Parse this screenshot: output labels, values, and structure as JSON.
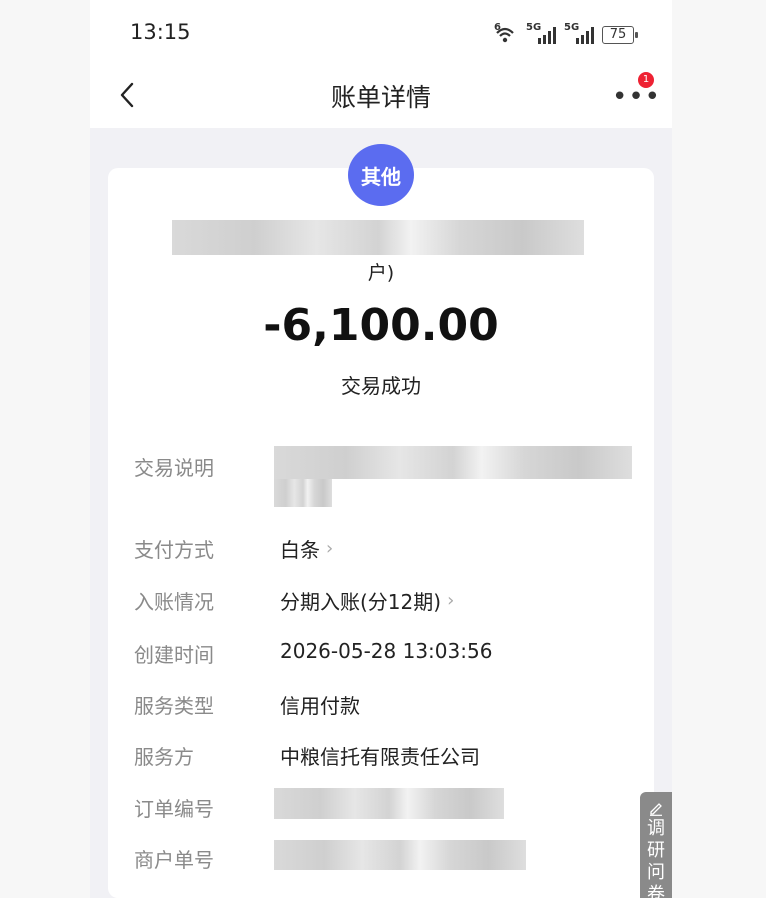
{
  "status_bar": {
    "time": "13:15",
    "wifi_label": "6",
    "sim1_label": "5G",
    "sim2_label": "5G",
    "battery": "75"
  },
  "nav": {
    "title": "账单详情",
    "notification_count": "1"
  },
  "transaction": {
    "category": "其他",
    "merchant_suffix": "户)",
    "amount": "-6,100.00",
    "status": "交易成功"
  },
  "details": [
    {
      "label": "交易说明",
      "value": ""
    },
    {
      "label": "支付方式",
      "value": "白条"
    },
    {
      "label": "入账情况",
      "value": "分期入账(分12期)"
    },
    {
      "label": "创建时间",
      "value": "2026-05-28 13:03:56"
    },
    {
      "label": "服务类型",
      "value": "信用付款"
    },
    {
      "label": "服务方",
      "value": "中粮信托有限责任公司"
    },
    {
      "label": "订单编号",
      "value": ""
    },
    {
      "label": "商户单号",
      "value": ""
    }
  ],
  "survey": {
    "label": "调研问卷"
  },
  "colors": {
    "category_badge": "#5b6cf0",
    "notification_badge": "#ee2233",
    "survey_tab": "#8a8a8a"
  }
}
